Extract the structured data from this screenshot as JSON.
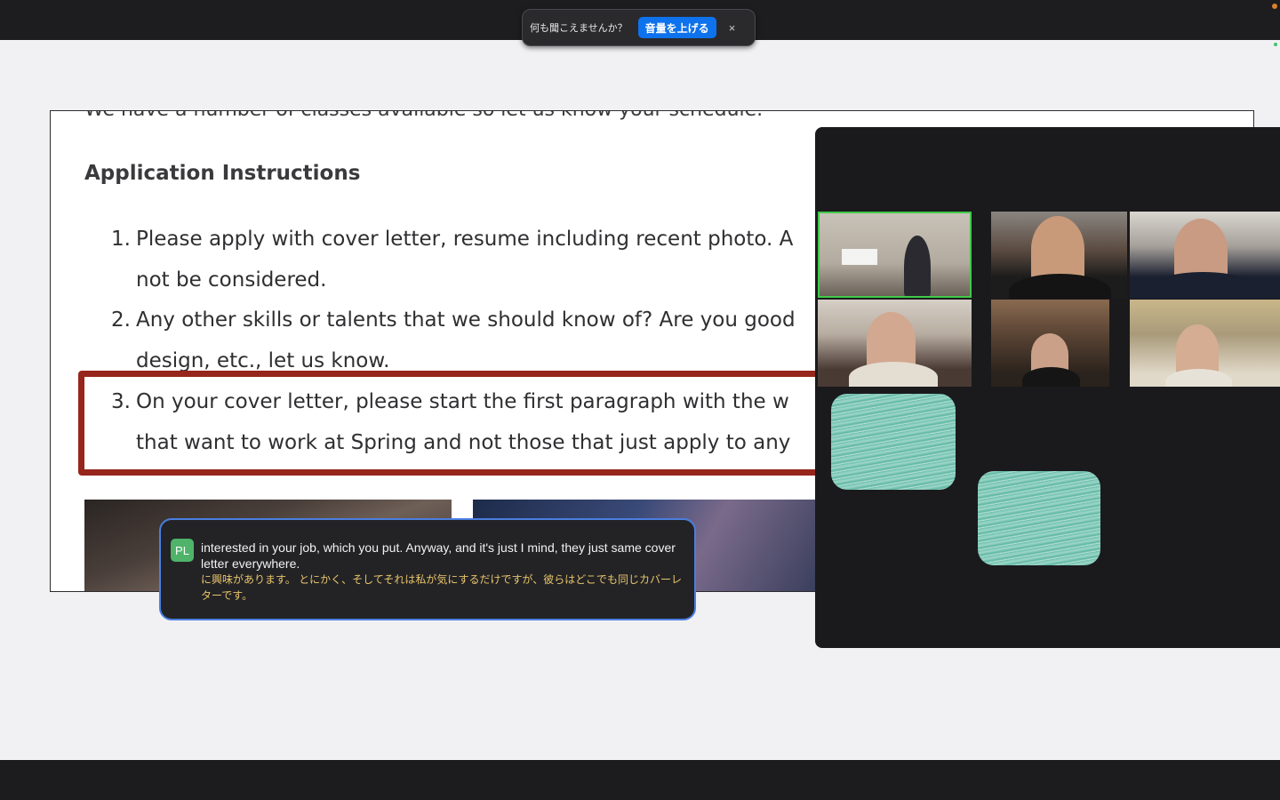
{
  "toast": {
    "message": "何も聞こえませんか？",
    "button": "音量を上げる",
    "close": "×"
  },
  "document": {
    "cut_line": "We have a number of classes available so let us know your schedule.",
    "heading": "Application Instructions",
    "items": [
      {
        "num": "1.",
        "lines": [
          "Please apply with cover letter, resume including recent photo. A",
          "not be considered."
        ]
      },
      {
        "num": "2.",
        "lines": [
          "Any other skills or talents that we should know of? Are you good",
          "design, etc., let us know."
        ]
      },
      {
        "num": "3.",
        "lines": [
          "On your cover letter, please start the first paragraph with the w",
          "that want to work at Spring and not those that just apply to any"
        ]
      }
    ]
  },
  "caption": {
    "avatar": "PL",
    "english": "interested in your job, which you put. Anyway, and it's just I mind, they just same cover letter everywhere.",
    "japanese": "に興味があります。 とにかく、そしてそれは私が気にするだけですが、彼らはどこでも同じカバーレターです。"
  },
  "video": {
    "colors": {
      "active_speaker": "#41c94a",
      "caption_border": "#4a7fe0",
      "highlight": "#96261c"
    }
  }
}
